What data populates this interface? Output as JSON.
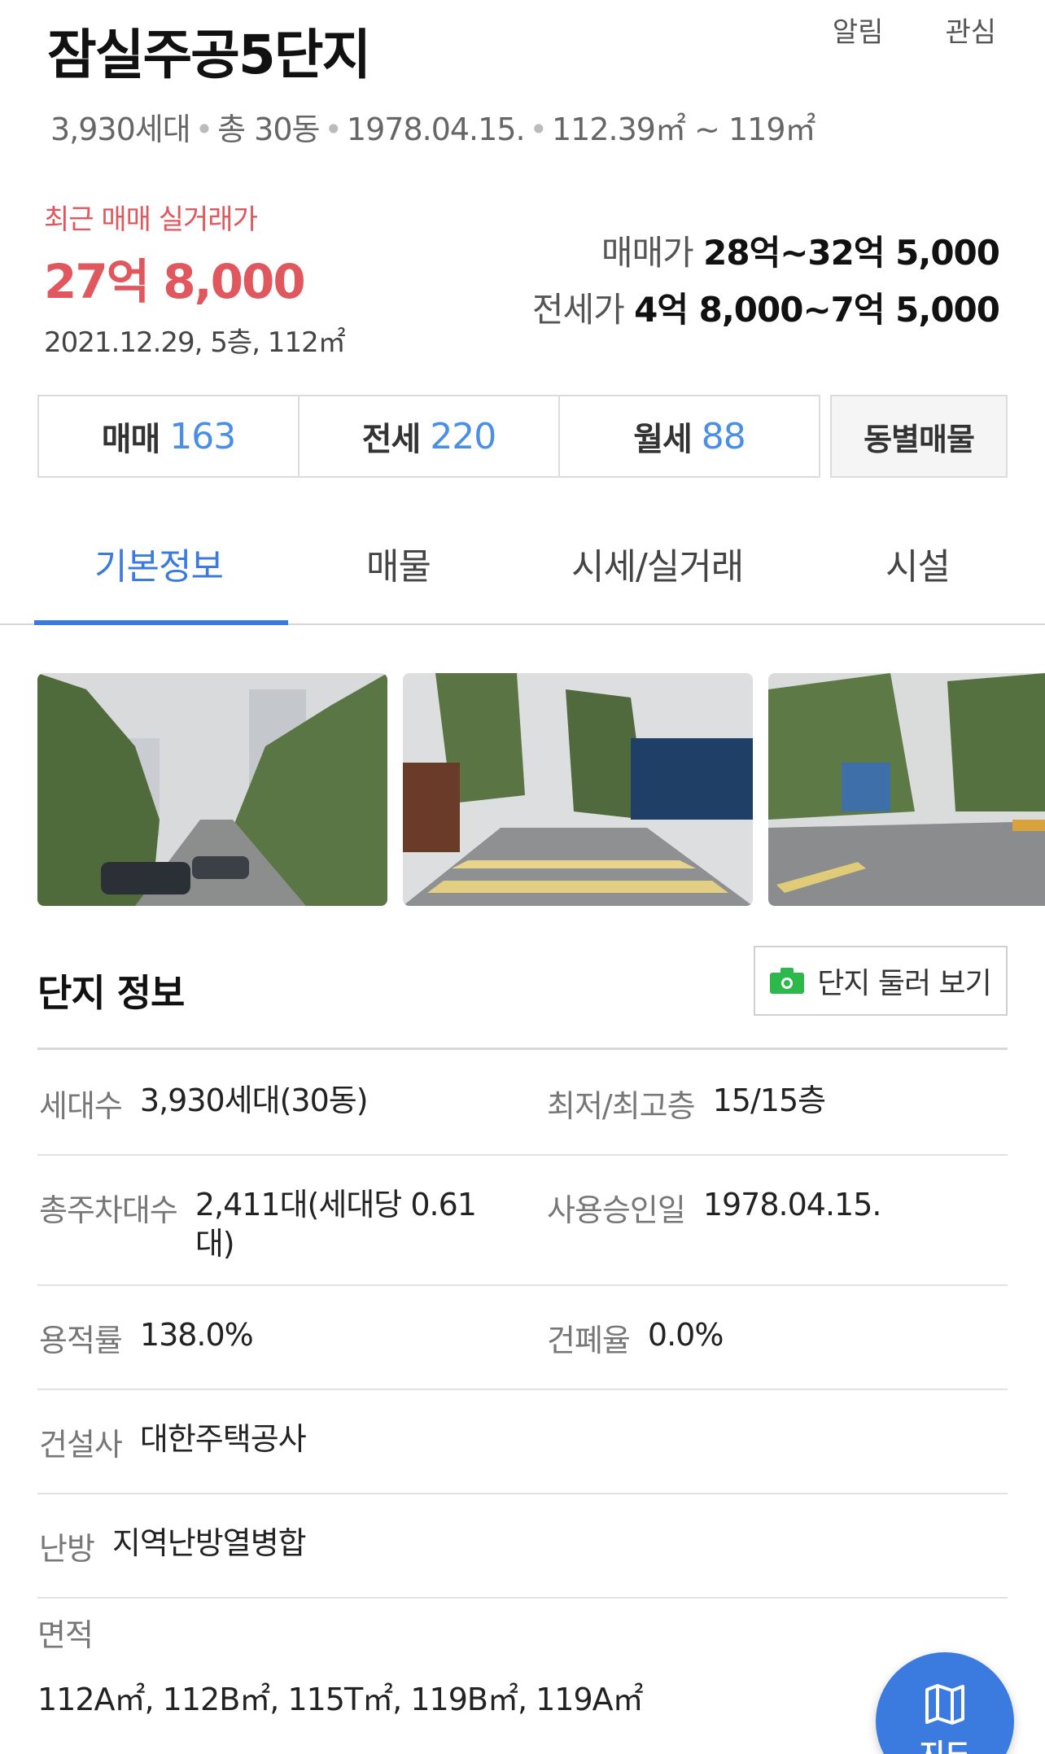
{
  "header": {
    "title": "잠실주공5단지",
    "alarm_label": "알림",
    "favorite_label": "관심",
    "meta": {
      "households": "3,930세대",
      "buildings": "총 30동",
      "approval_date": "1978.04.15.",
      "area_range": "112.39㎡ ~ 119㎡"
    }
  },
  "recent_trade": {
    "label": "최근 매매 실거래가",
    "price": "27억 8,000",
    "detail": "2021.12.29, 5층, 112㎡"
  },
  "price_ranges": {
    "sale_label": "매매가",
    "sale_value": "28억~32억 5,000",
    "jeonse_label": "전세가",
    "jeonse_value": "4억 8,000~7억 5,000"
  },
  "listing_counts": {
    "sale_label": "매매",
    "sale_count": "163",
    "jeonse_label": "전세",
    "jeonse_count": "220",
    "monthly_label": "월세",
    "monthly_count": "88",
    "by_building_label": "동별매물"
  },
  "tabs": [
    {
      "label": "기본정보",
      "active": true
    },
    {
      "label": "매물",
      "active": false
    },
    {
      "label": "시세/실거래",
      "active": false
    },
    {
      "label": "시설",
      "active": false
    }
  ],
  "complex_info": {
    "title": "단지 정보",
    "tour_button_label": "단지 둘러 보기",
    "rows": [
      {
        "left_label": "세대수",
        "left_value": "3,930세대(30동)",
        "right_label": "최저/최고층",
        "right_value": "15/15층"
      },
      {
        "left_label": "총주차대수",
        "left_value": "2,411대(세대당 0.61대)",
        "right_label": "사용승인일",
        "right_value": "1978.04.15."
      },
      {
        "left_label": "용적률",
        "left_value": "138.0%",
        "right_label": "건폐율",
        "right_value": "0.0%"
      },
      {
        "left_label": "건설사",
        "left_value": "대한주택공사"
      },
      {
        "left_label": "난방",
        "left_value": "지역난방열병합"
      }
    ],
    "area_label": "면적",
    "area_value": "112A㎡, 112B㎡, 115T㎡, 119B㎡, 119A㎡"
  },
  "map_button_label": "지도",
  "colors": {
    "accent_blue": "#3b7be0",
    "price_red": "#e0575d",
    "count_blue": "#4a8fe7",
    "camera_green": "#2db84b"
  }
}
